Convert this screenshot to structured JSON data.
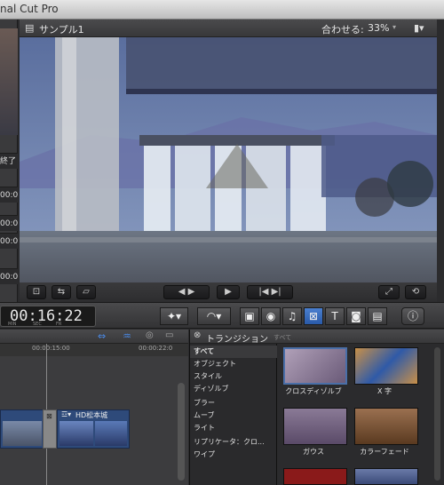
{
  "app": {
    "title": "nal Cut Pro"
  },
  "browser_stub": {
    "labels": [
      "終了",
      "00:0",
      "00:0",
      "00:0",
      "00:0"
    ]
  },
  "viewer": {
    "clip_name": "サンプル1",
    "zoom_label": "合わせる:",
    "zoom_value": "33%"
  },
  "toolbar": {
    "timecode": "00:16:22",
    "timecode_units": [
      "MIN",
      "SEC",
      "FR"
    ]
  },
  "timeline": {
    "ruler_left": "00:00:15:00",
    "ruler_right": "00:00:22:0",
    "clip_label": "HD松本城"
  },
  "transitions": {
    "title": "トランジション",
    "filter": "すべて",
    "categories": [
      "すべて",
      "オブジェクト",
      "スタイル",
      "ディゾルブ",
      "ブラー",
      "ムーブ",
      "ライト",
      "リプリケータ：クロ...",
      "ワイプ"
    ],
    "items": [
      {
        "label": "クロスディゾルブ",
        "color": "#7a6a86"
      },
      {
        "label": "X 字",
        "color": "#2f4f86"
      },
      {
        "label": "ガウス",
        "color": "#6b5a78"
      },
      {
        "label": "カラーフェード",
        "color": "#7a5030"
      }
    ]
  },
  "colors": {
    "accent": "#3a7bd5",
    "selected": "#4a6fa8"
  }
}
